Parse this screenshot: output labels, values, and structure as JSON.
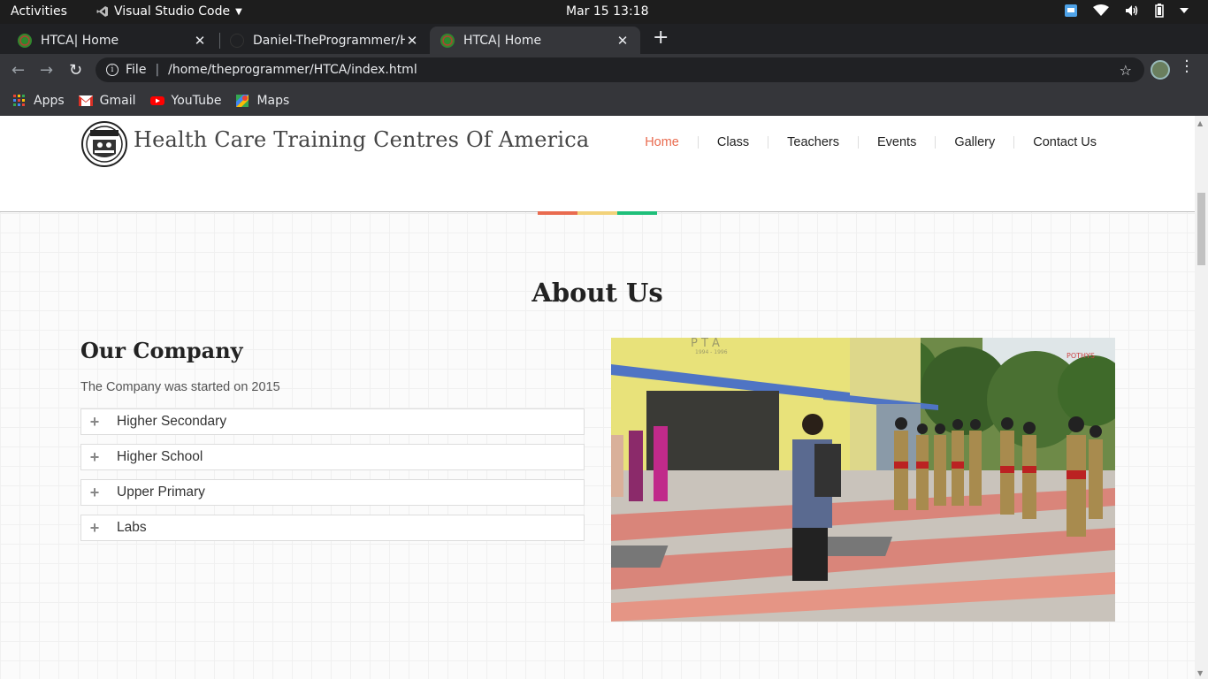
{
  "system": {
    "activities": "Activities",
    "app_name": "Visual Studio Code",
    "clock": "Mar 15  13:18"
  },
  "browser": {
    "tabs": [
      {
        "title": "HTCA| Home",
        "active": false
      },
      {
        "title": "Daniel-TheProgrammer/H",
        "active": false
      },
      {
        "title": "HTCA| Home",
        "active": true
      }
    ],
    "address": {
      "scheme_label": "File",
      "path": "/home/theprogrammer/HTCA/index.html"
    },
    "bookmarks": [
      {
        "label": "Apps",
        "icon": "apps-grid-icon"
      },
      {
        "label": "Gmail",
        "icon": "gmail-icon"
      },
      {
        "label": "YouTube",
        "icon": "youtube-icon"
      },
      {
        "label": "Maps",
        "icon": "maps-icon"
      }
    ]
  },
  "site": {
    "title": "Health Care Training Centres Of America",
    "nav": [
      {
        "label": "Home",
        "active": true
      },
      {
        "label": "Class",
        "active": false
      },
      {
        "label": "Teachers",
        "active": false
      },
      {
        "label": "Events",
        "active": false
      },
      {
        "label": "Gallery",
        "active": false
      },
      {
        "label": "Contact Us",
        "active": false
      }
    ],
    "accent_colors": [
      "#e96b4f",
      "#f2d27a",
      "#1fbf7a"
    ]
  },
  "about": {
    "heading": "About Us",
    "company_heading": "Our Company",
    "company_text": "The Company was started on 2015",
    "accordion": [
      "Higher Secondary",
      "Higher School",
      "Upper Primary",
      "Labs"
    ],
    "photo_sign_text": "P T A",
    "photo_sign_years": "1994 - 1996",
    "photo_watermark": "POTHYS"
  }
}
